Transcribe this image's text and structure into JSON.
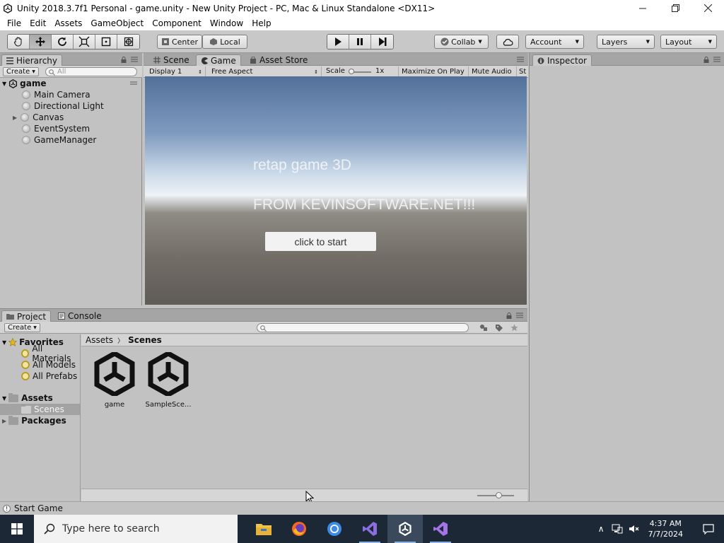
{
  "window": {
    "title": "Unity 2018.3.7f1 Personal - game.unity - New Unity Project - PC, Mac & Linux Standalone <DX11>"
  },
  "menu": [
    "File",
    "Edit",
    "Assets",
    "GameObject",
    "Component",
    "Window",
    "Help"
  ],
  "toolbar": {
    "pivot_label": "Center",
    "space_label": "Local",
    "collab_label": "Collab",
    "account_label": "Account",
    "layers_label": "Layers",
    "layout_label": "Layout"
  },
  "hierarchy": {
    "tab": "Hierarchy",
    "create_label": "Create",
    "search_placeholder": "All",
    "scene_name": "game",
    "items": [
      "Main Camera",
      "Directional Light",
      "Canvas",
      "EventSystem",
      "GameManager"
    ]
  },
  "center_tabs": [
    "Scene",
    "Game",
    "Asset Store"
  ],
  "game_toolbar": {
    "display": "Display 1",
    "aspect": "Free Aspect",
    "scale_label": "Scale",
    "scale_value": "1x",
    "maximize": "Maximize On Play",
    "mute": "Mute Audio",
    "stats": "St"
  },
  "game_view": {
    "title_text": "retap game 3D",
    "subtitle_text": "FROM KEVINSOFTWARE.NET!!!",
    "start_button": "click to start"
  },
  "inspector": {
    "tab": "Inspector"
  },
  "project": {
    "tabs": [
      "Project",
      "Console"
    ],
    "create_label": "Create",
    "favorites_label": "Favorites",
    "favorites": [
      "All Materials",
      "All Models",
      "All Prefabs"
    ],
    "assets_label": "Assets",
    "scenes_label": "Scenes",
    "packages_label": "Packages",
    "breadcrumb": [
      "Assets",
      "Scenes"
    ],
    "assets": [
      "game",
      "SampleSce..."
    ]
  },
  "status": {
    "message": "Start Game"
  },
  "taskbar": {
    "search_placeholder": "Type here to search",
    "time": "4:37 AM",
    "date": "7/7/2024"
  }
}
